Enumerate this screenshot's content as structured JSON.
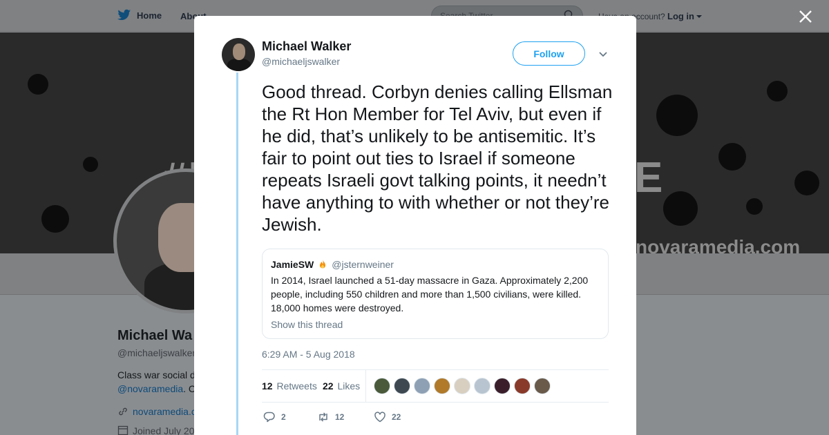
{
  "colors": {
    "accent": "#1da1f2",
    "thread_line": "#a8d6f5",
    "overlay_bg": "#8a8d90"
  },
  "background": {
    "nav": {
      "home_label": "Home",
      "about_label": "About",
      "search_placeholder": "Search Twitter",
      "have_account": "Have an account?",
      "login_label": "Log in"
    },
    "banner": {
      "hash_text": "#I",
      "end_text": "E",
      "url_text": "novaramedia.com"
    },
    "profile": {
      "name": "Michael Wa",
      "handle": "@michaeljswalker",
      "bio_line1": "Class war social d",
      "bio_link": "@novaramedia",
      "bio_after_link": ". C",
      "website": "novaramedia.c",
      "joined": "Joined July 20"
    }
  },
  "tweet": {
    "author_name": "Michael Walker",
    "author_handle": "@michaeljswalker",
    "follow_label": "Follow",
    "text": "Good thread. Corbyn denies calling Ellsman the Rt Hon Member for Tel Aviv, but even if he did, that’s unlikely to be antisemitic. It’s fair to point out ties to Israel if someone repeats Israeli govt talking points, it needn’t have anything to with whether or not they’re Jewish.",
    "quoted": {
      "name": "JamieSW",
      "emoji_icon": "fire-icon",
      "handle": "@jsternweiner",
      "text": "In 2014, Israel launched a 51-day massacre in Gaza. Approximately 2,200 people, including 550 children and more than 1,500 civilians, were killed. 18,000 homes were destroyed.",
      "show_thread": "Show this thread"
    },
    "timestamp": "6:29 AM - 5 Aug 2018",
    "retweets_count": "12",
    "retweets_label": "Retweets",
    "likes_count": "22",
    "likes_label": "Likes",
    "likers": [
      {
        "color": "#4a5a3a"
      },
      {
        "color": "#3d4850"
      },
      {
        "color": "#8ea0b4"
      },
      {
        "color": "#b07a2a"
      },
      {
        "color": "#d8cfc0"
      },
      {
        "color": "#b8c4d0"
      },
      {
        "color": "#3a1f2a"
      },
      {
        "color": "#8a3a2a"
      },
      {
        "color": "#6a5a4a"
      }
    ],
    "actions": {
      "reply_count": "2",
      "retweet_count": "12",
      "like_count": "22"
    }
  }
}
